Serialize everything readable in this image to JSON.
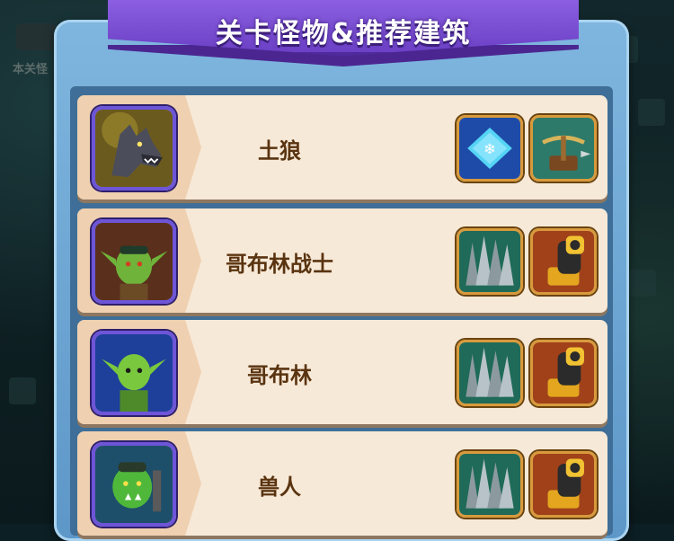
{
  "background": {
    "label": "本关怪"
  },
  "header": {
    "title": "关卡怪物&推荐建筑"
  },
  "monsters": [
    {
      "name": "土狼",
      "portrait_icon": "wolf-portrait",
      "recommended": [
        {
          "icon": "ice-trap-icon"
        },
        {
          "icon": "crossbow-tower-icon"
        }
      ]
    },
    {
      "name": "哥布林战士",
      "portrait_icon": "goblin-warrior-portrait",
      "recommended": [
        {
          "icon": "spike-trap-icon"
        },
        {
          "icon": "cannon-tower-icon"
        }
      ]
    },
    {
      "name": "哥布林",
      "portrait_icon": "goblin-portrait",
      "recommended": [
        {
          "icon": "spike-trap-icon"
        },
        {
          "icon": "cannon-tower-icon"
        }
      ]
    },
    {
      "name": "兽人",
      "portrait_icon": "orc-portrait",
      "recommended": [
        {
          "icon": "spike-trap-icon"
        },
        {
          "icon": "cannon-tower-icon"
        }
      ]
    }
  ],
  "colors": {
    "ribbon": "#7a4fd6",
    "frame": "#6fa8d8",
    "row": "#f7e9d8",
    "name_text": "#5a3410"
  }
}
